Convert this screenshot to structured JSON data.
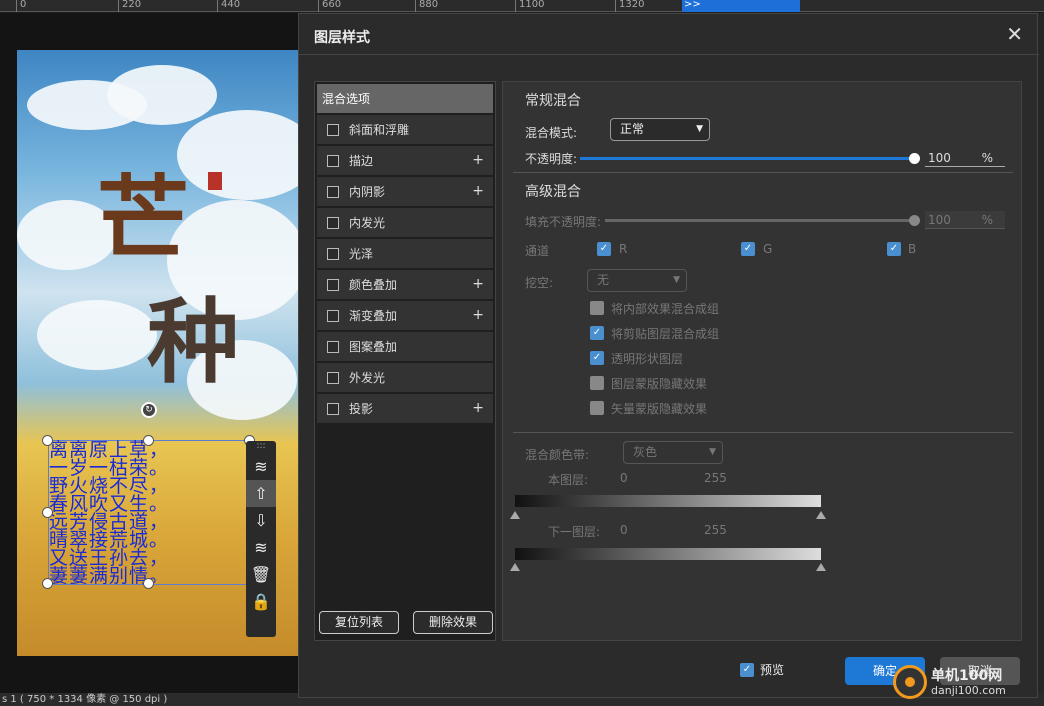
{
  "ruler": {
    "ticks": [
      "0",
      "220",
      "440",
      "660",
      "880",
      "1100",
      "1320"
    ],
    "overflow": ">>"
  },
  "canvas": {
    "big_chars": [
      "芒",
      "种"
    ],
    "poem_lines": [
      "离离原上草，",
      "一岁一枯荣。",
      "野火烧不尽，",
      "春风吹又生。",
      "远芳侵古道，",
      "晴翠接荒城。",
      "又送王孙去，",
      "萋萋满别情。"
    ]
  },
  "status": {
    "text": "s 1 ( 750 * 1334 像素 @ 150 dpi )"
  },
  "dialog": {
    "title": "图层样式",
    "close_icon": "close-icon",
    "left_list": [
      {
        "label": "混合选项",
        "checkbox": false,
        "plus": false,
        "selected": true
      },
      {
        "label": "斜面和浮雕",
        "checkbox": true,
        "plus": false
      },
      {
        "label": "描边",
        "checkbox": true,
        "plus": true
      },
      {
        "label": "内阴影",
        "checkbox": true,
        "plus": true
      },
      {
        "label": "内发光",
        "checkbox": true,
        "plus": false
      },
      {
        "label": "光泽",
        "checkbox": true,
        "plus": false
      },
      {
        "label": "颜色叠加",
        "checkbox": true,
        "plus": true
      },
      {
        "label": "渐变叠加",
        "checkbox": true,
        "plus": true
      },
      {
        "label": "图案叠加",
        "checkbox": true,
        "plus": false
      },
      {
        "label": "外发光",
        "checkbox": true,
        "plus": false
      },
      {
        "label": "投影",
        "checkbox": true,
        "plus": true
      }
    ],
    "reset_list": "复位列表",
    "delete_effect": "删除效果",
    "general_blend": {
      "section": "常规混合",
      "mode_label": "混合模式:",
      "mode_value": "正常",
      "opacity_label": "不透明度:",
      "opacity_value": "100",
      "opacity_unit": "%",
      "opacity_level": 1.0
    },
    "advanced_blend": {
      "section": "高级混合",
      "fill_label": "填充不透明度:",
      "fill_value": "100",
      "fill_unit": "%",
      "channel_label": "通道",
      "channels": [
        "R",
        "G",
        "B"
      ],
      "knockout_label": "挖空:",
      "knockout_value": "无",
      "options": [
        {
          "label": "将内部效果混合成组",
          "checked": false
        },
        {
          "label": "将剪贴图层混合成组",
          "checked": true
        },
        {
          "label": "透明形状图层",
          "checked": true
        },
        {
          "label": "图层蒙版隐藏效果",
          "checked": false
        },
        {
          "label": "矢量蒙版隐藏效果",
          "checked": false
        }
      ]
    },
    "blend_if": {
      "label": "混合颜色带:",
      "value": "灰色",
      "this_layer": "本图层:",
      "underlying": "下一图层:",
      "min": "0",
      "max": "255"
    },
    "preview": "预览",
    "ok": "确定",
    "cancel": "取消"
  },
  "watermark": {
    "title": "单机100网",
    "url": "danji100.com"
  },
  "colors": {
    "accent": "#1e78d6",
    "dialog_bg": "#2b2b2b",
    "poem_text": "#1a2bd6",
    "title_char": "#6b3a1d"
  }
}
